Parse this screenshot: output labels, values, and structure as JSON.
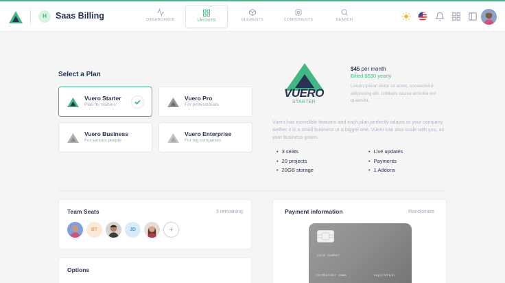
{
  "app": {
    "title": "Saas Billing",
    "badge": "H",
    "accent": "#41b883"
  },
  "nav": [
    {
      "label": "DASHBOARDS",
      "icon": "activity-icon"
    },
    {
      "label": "LAYOUTS",
      "icon": "grid-icon",
      "active": true
    },
    {
      "label": "ELEMENTS",
      "icon": "box-icon"
    },
    {
      "label": "COMPONENTS",
      "icon": "settings-icon"
    },
    {
      "label": "SEARCH",
      "icon": "search-icon"
    }
  ],
  "plans": {
    "title": "Select a Plan",
    "items": [
      {
        "name": "Vuero Starter",
        "desc": "Plan for starters",
        "selected": true
      },
      {
        "name": "Vuero Pro",
        "desc": "For professionals"
      },
      {
        "name": "Vuero Business",
        "desc": "For serious people"
      },
      {
        "name": "Vuero Enterprise",
        "desc": "For big companies"
      }
    ]
  },
  "summary": {
    "logo_word": "VUERO",
    "logo_sub": "STARTER",
    "price": "$45",
    "price_suffix": "per month",
    "billed": "Billed $530 yearly",
    "lorem": "Lorem ipsum dolor sit amet, consectetur adipiscing elit. Utilitatis causa amicitia est quaesita.",
    "paragraph": "Vuero has incredible features and each plan perfectly adapts to your company, wether it is a small business or a bigger one. Vuero can also scale with you, as your business grows.",
    "features_left": [
      "3 seats",
      "20 projects",
      "20GB storage"
    ],
    "features_right": [
      "Live updates",
      "Payments",
      "1 Addons"
    ]
  },
  "team": {
    "title": "Team Seats",
    "remaining": "3 remaining",
    "seats": [
      {
        "type": "photo",
        "color": "#7e9fd8"
      },
      {
        "type": "initials",
        "initials": "BT",
        "bg": "#fde9d6",
        "fg": "#f0a35a"
      },
      {
        "type": "photo",
        "color": "#6b5a55"
      },
      {
        "type": "initials",
        "initials": "JD",
        "bg": "#d7ecfb",
        "fg": "#4aa3df"
      },
      {
        "type": "photo",
        "color": "#a06e5a"
      }
    ],
    "add_label": "+"
  },
  "options": {
    "title": "Options"
  },
  "payment": {
    "title": "Payment information",
    "randomize": "Randomize",
    "card_number_label": "card number",
    "holder_label": "cardholder name",
    "expiration_label": "expiration"
  }
}
